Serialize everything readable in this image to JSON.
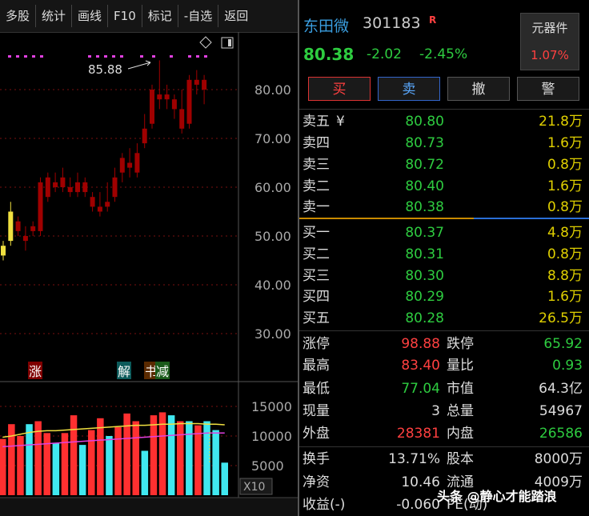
{
  "toolbar": {
    "items": [
      "多股",
      "统计",
      "画线",
      "F10",
      "标记",
      "-自选",
      "返回"
    ]
  },
  "stock": {
    "name": "东田微",
    "code": "301183",
    "badge": "R",
    "price": "80.38",
    "change": "-2.02",
    "change_pct": "-2.45%"
  },
  "sector": {
    "name": "元器件",
    "pct": "1.07%"
  },
  "buttons": {
    "buy": "买",
    "sell": "卖",
    "cancel": "撤",
    "alert": "警"
  },
  "orderbook": {
    "asks": [
      {
        "label": "卖五",
        "flag": "¥",
        "price": "80.80",
        "vol": "21.8万"
      },
      {
        "label": "卖四",
        "flag": "",
        "price": "80.73",
        "vol": "1.6万"
      },
      {
        "label": "卖三",
        "flag": "",
        "price": "80.72",
        "vol": "0.8万"
      },
      {
        "label": "卖二",
        "flag": "",
        "price": "80.40",
        "vol": "1.6万"
      },
      {
        "label": "卖一",
        "flag": "",
        "price": "80.38",
        "vol": "0.8万"
      }
    ],
    "bids": [
      {
        "label": "买一",
        "price": "80.37",
        "vol": "4.8万"
      },
      {
        "label": "买二",
        "price": "80.31",
        "vol": "0.8万"
      },
      {
        "label": "买三",
        "price": "80.30",
        "vol": "8.8万"
      },
      {
        "label": "买四",
        "price": "80.29",
        "vol": "1.6万"
      },
      {
        "label": "买五",
        "price": "80.28",
        "vol": "26.5万"
      }
    ]
  },
  "stats": {
    "zhangting_l": "涨停",
    "zhangting": "98.88",
    "dieting_l": "跌停",
    "dieting": "65.92",
    "zuigao_l": "最高",
    "zuigao": "83.40",
    "liangbi_l": "量比",
    "liangbi": "0.93",
    "zuidi_l": "最低",
    "zuidi": "77.04",
    "shizhi_l": "市值",
    "shizhi": "64.3亿",
    "xianliang_l": "现量",
    "xianliang": "3",
    "zongliang_l": "总量",
    "zongliang": "54967",
    "waipan_l": "外盘",
    "waipan": "28381",
    "neipan_l": "内盘",
    "neipan": "26586",
    "huanshou_l": "换手",
    "huanshou": "13.71%",
    "guben_l": "股本",
    "guben": "8000万",
    "jingzi_l": "净资",
    "jingzi": "10.46",
    "liutong_l": "流通",
    "liutong": "4009万",
    "shouyi_l": "收益(-)",
    "shouyi": "-0.060",
    "pe_l": "PE(动)",
    "pe": ""
  },
  "watermark": "头条 @静心才能踏浪",
  "chart_data": {
    "type": "candlestick",
    "price_axis": {
      "ticks": [
        "80.00",
        "70.00",
        "60.00",
        "50.00",
        "40.00",
        "30.00"
      ],
      "values": [
        80,
        70,
        60,
        50,
        40,
        30
      ]
    },
    "max_label": "85.88",
    "markers": [
      "涨",
      "解",
      "书",
      "减"
    ],
    "volume_axis": {
      "ticks": [
        "15000",
        "10000",
        "5000"
      ],
      "values": [
        15000,
        10000,
        5000
      ],
      "unit_label": "X10"
    },
    "candles": [
      {
        "o": 46,
        "c": 48,
        "h": 49,
        "l": 45,
        "color": "yellow"
      },
      {
        "o": 49,
        "c": 55,
        "h": 57,
        "l": 48,
        "color": "yellow"
      },
      {
        "o": 53,
        "c": 51,
        "h": 54,
        "l": 50,
        "color": "darkred"
      },
      {
        "o": 50,
        "c": 49,
        "h": 52,
        "l": 47,
        "color": "darkred"
      },
      {
        "o": 52,
        "c": 51,
        "h": 53,
        "l": 50,
        "color": "darkred"
      },
      {
        "o": 51,
        "c": 61,
        "h": 62,
        "l": 50,
        "color": "darkred"
      },
      {
        "o": 62,
        "c": 58,
        "h": 63,
        "l": 57,
        "color": "darkred"
      },
      {
        "o": 60,
        "c": 61,
        "h": 63,
        "l": 59,
        "color": "darkred"
      },
      {
        "o": 62,
        "c": 60,
        "h": 64,
        "l": 59,
        "color": "darkred"
      },
      {
        "o": 60,
        "c": 59,
        "h": 62,
        "l": 58,
        "color": "darkred"
      },
      {
        "o": 59,
        "c": 61,
        "h": 63,
        "l": 58,
        "color": "darkred"
      },
      {
        "o": 61,
        "c": 59,
        "h": 62,
        "l": 58,
        "color": "darkred"
      },
      {
        "o": 58,
        "c": 56,
        "h": 59,
        "l": 55,
        "color": "darkred"
      },
      {
        "o": 56,
        "c": 55,
        "h": 59,
        "l": 54,
        "color": "darkred"
      },
      {
        "o": 56,
        "c": 57,
        "h": 61,
        "l": 55,
        "color": "darkred"
      },
      {
        "o": 58,
        "c": 62,
        "h": 64,
        "l": 57,
        "color": "darkred"
      },
      {
        "o": 63,
        "c": 66,
        "h": 67,
        "l": 61,
        "color": "darkred"
      },
      {
        "o": 65,
        "c": 64,
        "h": 68,
        "l": 62,
        "color": "darkred"
      },
      {
        "o": 63,
        "c": 67,
        "h": 69,
        "l": 62,
        "color": "darkred"
      },
      {
        "o": 69,
        "c": 72,
        "h": 75,
        "l": 68,
        "color": "darkred"
      },
      {
        "o": 73,
        "c": 80,
        "h": 81,
        "l": 72,
        "color": "darkred"
      },
      {
        "o": 79,
        "c": 78,
        "h": 86,
        "l": 76,
        "color": "darkred"
      },
      {
        "o": 79,
        "c": 78,
        "h": 81,
        "l": 76,
        "color": "darkred"
      },
      {
        "o": 76,
        "c": 78,
        "h": 79,
        "l": 74,
        "color": "darkred"
      },
      {
        "o": 76,
        "c": 72,
        "h": 80,
        "l": 71,
        "color": "darkred"
      },
      {
        "o": 73,
        "c": 82,
        "h": 83,
        "l": 72,
        "color": "darkred"
      },
      {
        "o": 82,
        "c": 81,
        "h": 84,
        "l": 79,
        "color": "darkred"
      },
      {
        "o": 82,
        "c": 80,
        "h": 83,
        "l": 77,
        "color": "darkred"
      }
    ],
    "volumes": [
      {
        "v": 9500,
        "c": "red"
      },
      {
        "v": 12000,
        "c": "red"
      },
      {
        "v": 10000,
        "c": "red"
      },
      {
        "v": 12000,
        "c": "cyan"
      },
      {
        "v": 12500,
        "c": "red"
      },
      {
        "v": 10500,
        "c": "red"
      },
      {
        "v": 8800,
        "c": "cyan"
      },
      {
        "v": 10500,
        "c": "red"
      },
      {
        "v": 13500,
        "c": "red"
      },
      {
        "v": 8500,
        "c": "cyan"
      },
      {
        "v": 11000,
        "c": "red"
      },
      {
        "v": 13000,
        "c": "red"
      },
      {
        "v": 10000,
        "c": "cyan"
      },
      {
        "v": 11500,
        "c": "red"
      },
      {
        "v": 13800,
        "c": "red"
      },
      {
        "v": 12500,
        "c": "red"
      },
      {
        "v": 7500,
        "c": "cyan"
      },
      {
        "v": 13500,
        "c": "red"
      },
      {
        "v": 14000,
        "c": "red"
      },
      {
        "v": 13500,
        "c": "cyan"
      },
      {
        "v": 12500,
        "c": "red"
      },
      {
        "v": 12500,
        "c": "cyan"
      },
      {
        "v": 11800,
        "c": "red"
      },
      {
        "v": 12500,
        "c": "cyan"
      },
      {
        "v": 11000,
        "c": "cyan"
      },
      {
        "v": 5500,
        "c": "cyan"
      }
    ],
    "ma_yellow": [
      9800,
      10000,
      10300,
      10600,
      10800,
      10900,
      10900,
      11000,
      11100,
      11200,
      11300,
      11400,
      11500,
      11600,
      11700,
      11800,
      11800,
      11900,
      12000,
      12000,
      12100,
      12100,
      12100,
      12000,
      12000,
      11900
    ],
    "ma_magenta": [
      8200,
      8300,
      8400,
      8500,
      8600,
      8700,
      8800,
      8900,
      9000,
      9100,
      9200,
      9300,
      9400,
      9500,
      9600,
      9700,
      9800,
      9900,
      10000,
      10100,
      10200,
      10300,
      10400,
      10500,
      10500,
      10500
    ]
  }
}
